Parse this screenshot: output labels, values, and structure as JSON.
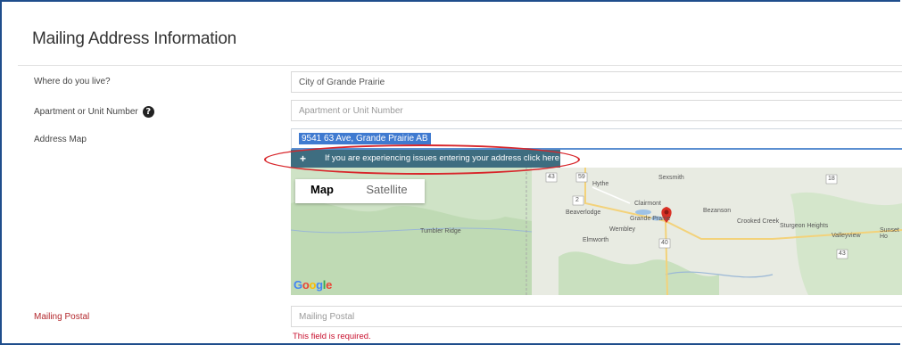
{
  "section": {
    "title": "Mailing Address Information"
  },
  "fields": {
    "where_live": {
      "label": "Where do you live?",
      "value": "City of Grande Prairie"
    },
    "apartment": {
      "label": "Apartment or Unit Number",
      "placeholder": "Apartment or Unit Number"
    },
    "address_map": {
      "label": "Address Map",
      "value": "9541 63 Ave, Grande Prairie AB"
    },
    "mailing_postal": {
      "label": "Mailing Postal",
      "placeholder": "Mailing Postal",
      "error": "This field is required."
    }
  },
  "issue_banner": {
    "icon": "plus-icon",
    "text": "If you are experiencing issues entering your address click here"
  },
  "map": {
    "tabs": {
      "map": "Map",
      "satellite": "Satellite"
    },
    "provider": "Google",
    "place_labels": [
      "Hythe",
      "Clairmont",
      "Beaverlodge",
      "Bezanson",
      "Grande Prairie",
      "Crooked Creek",
      "Sturgeon Heights",
      "Wembley",
      "Valleyview",
      "Sunset Ho",
      "Elmworth",
      "Tumbler Ridge",
      "Sexsmith"
    ],
    "highway_numbers": [
      "43",
      "59",
      "2",
      "40",
      "43",
      "18"
    ]
  },
  "colors": {
    "accent": "#3e6d80",
    "error": "#c8102e",
    "highlight": "#d8262b",
    "frame": "#1f4e8c"
  }
}
